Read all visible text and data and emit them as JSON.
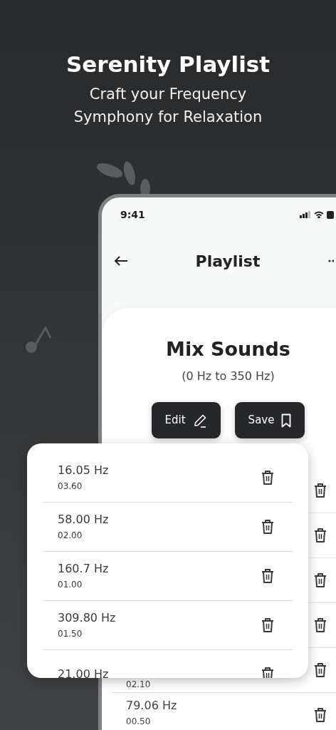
{
  "header": {
    "title": "Serenity Playlist",
    "subtitle": "Craft your Frequency Symphony for Relaxation"
  },
  "phone": {
    "status_time": "9:41",
    "nav_title": "Playlist",
    "mix_title": "Mix Sounds",
    "range": "(0 Hz to 350 Hz)",
    "buttons": [
      {
        "label": "Edit",
        "kind": "pencil"
      },
      {
        "label": "Save",
        "kind": "bookmark"
      }
    ],
    "background_rows": [
      {
        "kind": "hidden"
      },
      {
        "kind": "hidden"
      },
      {
        "kind": "hidden"
      },
      {
        "kind": "hidden"
      },
      {
        "kind": "shown",
        "duration": "02.10"
      },
      {
        "kind": "shown",
        "frequency": "79.06 Hz",
        "duration": "00.50"
      }
    ]
  },
  "floating_card": {
    "tracks": [
      {
        "frequency": "16.05 Hz",
        "duration": "03.60"
      },
      {
        "frequency": "58.00 Hz",
        "duration": "02.00"
      },
      {
        "frequency": "160.7 Hz",
        "duration": "01.00"
      },
      {
        "frequency": "309.80 Hz",
        "duration": "01.50"
      },
      {
        "frequency": "21.00 Hz"
      }
    ]
  }
}
